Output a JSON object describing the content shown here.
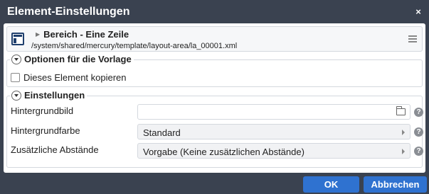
{
  "dialog": {
    "title": "Element-Einstellungen",
    "close_label": "×"
  },
  "resource": {
    "icon": "layout-area-icon",
    "title": "Bereich - Eine Zeile",
    "path": "/system/shared/mercury/template/layout-area/la_00001.xml"
  },
  "options_group": {
    "legend": "Optionen für die Vorlage",
    "checkbox_label": "Dieses Element kopieren",
    "checkbox_checked": false
  },
  "settings_group": {
    "legend": "Einstellungen",
    "fields": [
      {
        "label": "Hintergrundbild",
        "value": "",
        "type": "file"
      },
      {
        "label": "Hintergrundfarbe",
        "value": "Standard",
        "type": "select"
      },
      {
        "label": "Zusätzliche Abstände",
        "value": "Vorgabe (Keine zusätzlichen Abstände)",
        "type": "select"
      }
    ],
    "help_label": "?"
  },
  "buttons": {
    "ok": "OK",
    "cancel": "Abbrechen"
  },
  "colors": {
    "titlebar": "#3a4250",
    "primary_button": "#2f72d0"
  }
}
